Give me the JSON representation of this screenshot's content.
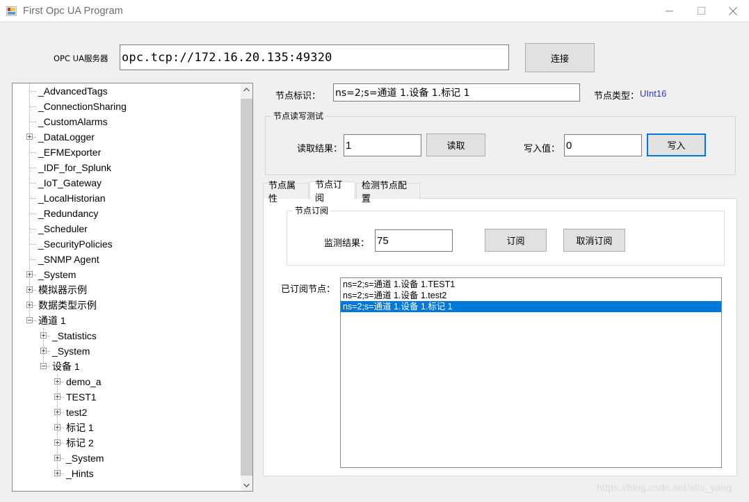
{
  "window": {
    "title": "First Opc UA Program",
    "icon": "windows-form-icon",
    "minimize_label": "—",
    "maximize_label": "□",
    "close_label": "✕"
  },
  "connection": {
    "server_label": "OPC UA服务器",
    "server_url": "opc.tcp://172.16.20.135:49320",
    "connect_button": "连接"
  },
  "tree": {
    "scroll_up_icon": "chevron-up-icon",
    "scroll_down_icon": "chevron-down-icon",
    "nodes": [
      {
        "label": "_AdvancedTags",
        "depth": 1,
        "expander": "none"
      },
      {
        "label": "_ConnectionSharing",
        "depth": 1,
        "expander": "none"
      },
      {
        "label": "_CustomAlarms",
        "depth": 1,
        "expander": "none"
      },
      {
        "label": "_DataLogger",
        "depth": 1,
        "expander": "plus"
      },
      {
        "label": "_EFMExporter",
        "depth": 1,
        "expander": "none"
      },
      {
        "label": "_IDF_for_Splunk",
        "depth": 1,
        "expander": "none"
      },
      {
        "label": "_IoT_Gateway",
        "depth": 1,
        "expander": "none"
      },
      {
        "label": "_LocalHistorian",
        "depth": 1,
        "expander": "none"
      },
      {
        "label": "_Redundancy",
        "depth": 1,
        "expander": "none"
      },
      {
        "label": "_Scheduler",
        "depth": 1,
        "expander": "none"
      },
      {
        "label": "_SecurityPolicies",
        "depth": 1,
        "expander": "none"
      },
      {
        "label": "_SNMP Agent",
        "depth": 1,
        "expander": "none"
      },
      {
        "label": "_System",
        "depth": 1,
        "expander": "plus"
      },
      {
        "label": "模拟器示例",
        "depth": 1,
        "expander": "plus"
      },
      {
        "label": "数据类型示例",
        "depth": 1,
        "expander": "plus"
      },
      {
        "label": "通道 1",
        "depth": 1,
        "expander": "minus"
      },
      {
        "label": "_Statistics",
        "depth": 2,
        "expander": "plus"
      },
      {
        "label": "_System",
        "depth": 2,
        "expander": "plus"
      },
      {
        "label": "设备 1",
        "depth": 2,
        "expander": "minus"
      },
      {
        "label": "demo_a",
        "depth": 3,
        "expander": "plus"
      },
      {
        "label": "TEST1",
        "depth": 3,
        "expander": "plus"
      },
      {
        "label": "test2",
        "depth": 3,
        "expander": "plus"
      },
      {
        "label": "标记 1",
        "depth": 3,
        "expander": "plus"
      },
      {
        "label": "标记 2",
        "depth": 3,
        "expander": "plus"
      },
      {
        "label": "_System",
        "depth": 3,
        "expander": "plus"
      },
      {
        "label": "_Hints",
        "depth": 3,
        "expander": "plus"
      }
    ]
  },
  "node_header": {
    "id_label": "节点标识：",
    "id_value": "ns=2;s=通道 1.设备 1.标记 1",
    "type_label": "节点类型：",
    "type_value": "UInt16",
    "type_color": "#3333cc"
  },
  "rw_test": {
    "group_title": "节点读写测试",
    "read_result_label": "读取结果：",
    "read_result_value": "1",
    "read_button": "读取",
    "write_value_label": "写入值：",
    "write_value": "0",
    "write_button": "写入"
  },
  "tabs": [
    {
      "label": "节点属性",
      "active": false
    },
    {
      "label": "节点订阅",
      "active": true
    },
    {
      "label": "检测节点配置",
      "active": false
    }
  ],
  "subscription": {
    "group_title": "节点订阅",
    "monitor_label": "监测结果：",
    "monitor_value": "75",
    "subscribe_button": "订阅",
    "unsubscribe_button": "取消订阅",
    "list_label": "已订阅节点：",
    "items": [
      {
        "text": "ns=2;s=通道 1.设备 1.TEST1",
        "selected": false
      },
      {
        "text": "ns=2;s=通道 1.设备 1.test2",
        "selected": false
      },
      {
        "text": "ns=2;s=通道 1.设备 1.标记 1",
        "selected": true
      }
    ]
  },
  "watermark": "https://blog.csdn.net/elis_yang",
  "colors": {
    "accent": "#0078d7",
    "window_bg": "#f0f0f0",
    "field_bg": "#ffffff",
    "button_bg": "#e1e1e1"
  }
}
